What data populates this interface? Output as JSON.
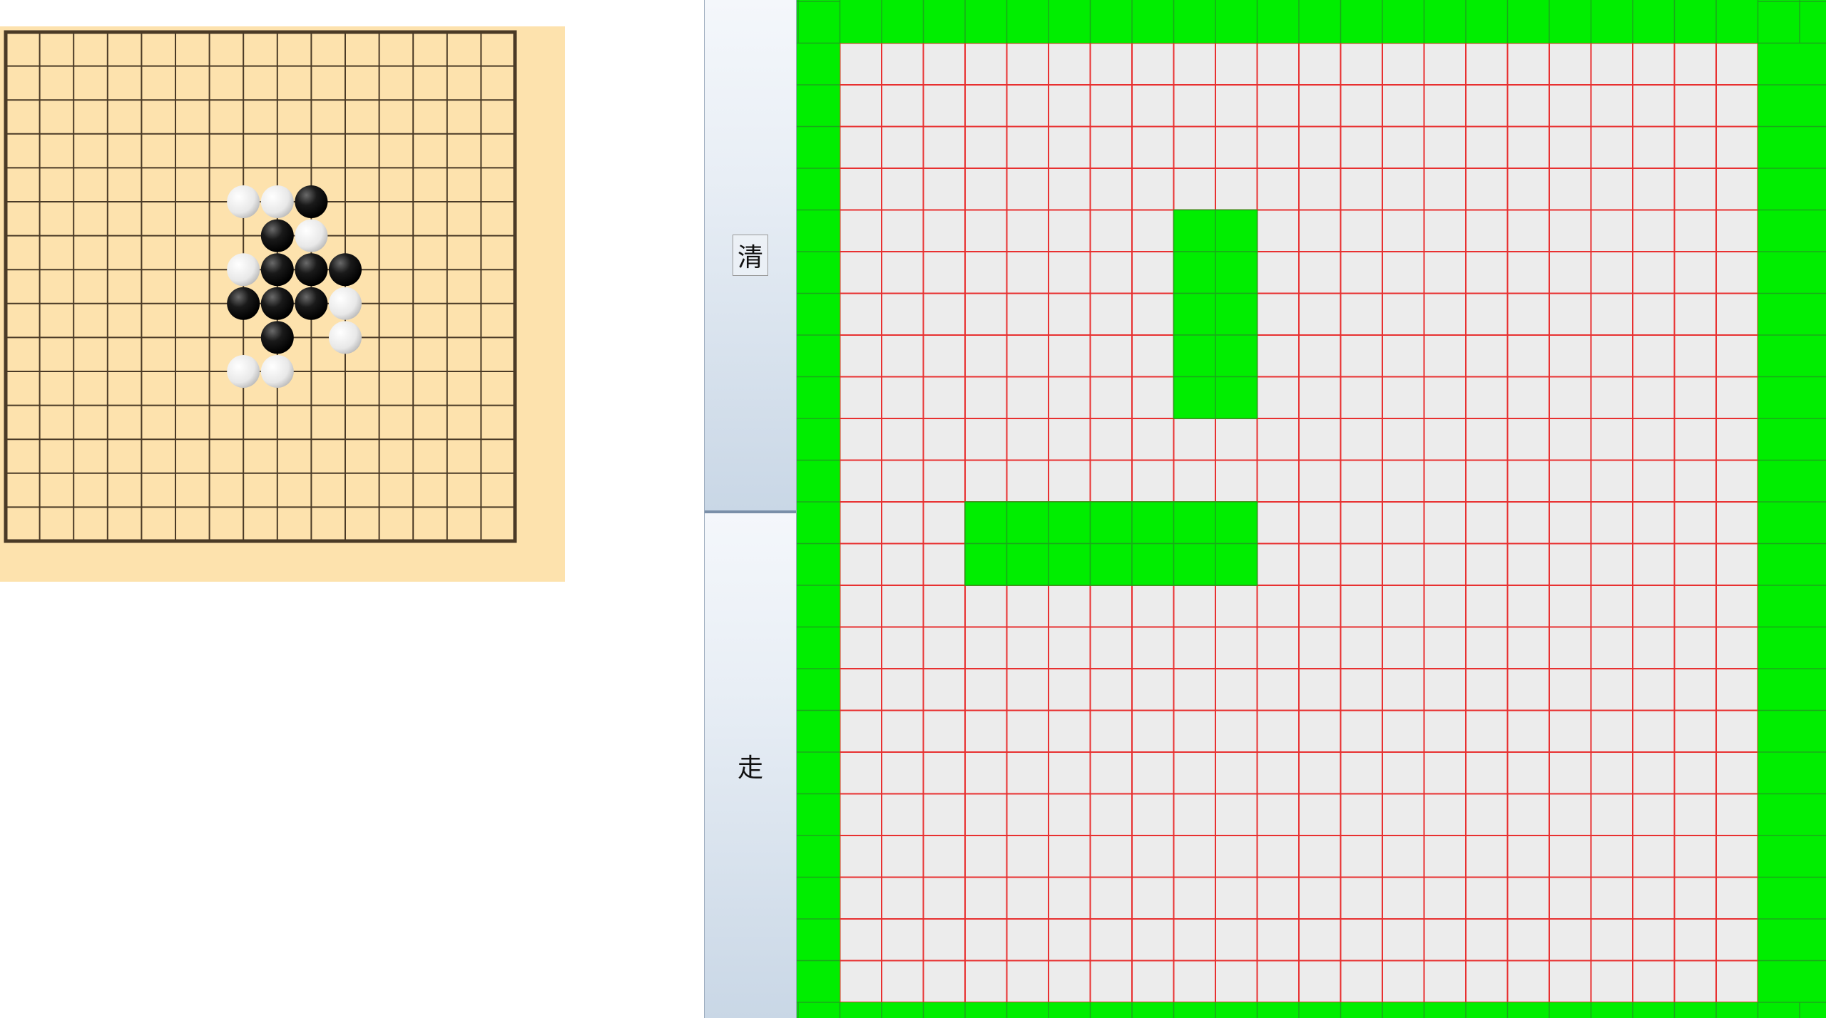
{
  "go_board": {
    "lines": 16,
    "colors": {
      "board": "#fde2ad",
      "line": "#4a3a26"
    },
    "stones": [
      {
        "color": "white",
        "col": 7,
        "row": 5
      },
      {
        "color": "white",
        "col": 8,
        "row": 5
      },
      {
        "color": "black",
        "col": 9,
        "row": 5
      },
      {
        "color": "black",
        "col": 8,
        "row": 6
      },
      {
        "color": "white",
        "col": 9,
        "row": 6
      },
      {
        "color": "white",
        "col": 7,
        "row": 7
      },
      {
        "color": "black",
        "col": 8,
        "row": 7
      },
      {
        "color": "black",
        "col": 9,
        "row": 7
      },
      {
        "color": "black",
        "col": 10,
        "row": 7
      },
      {
        "color": "black",
        "col": 7,
        "row": 8
      },
      {
        "color": "black",
        "col": 8,
        "row": 8
      },
      {
        "color": "black",
        "col": 9,
        "row": 8
      },
      {
        "color": "white",
        "col": 10,
        "row": 8
      },
      {
        "color": "black",
        "col": 8,
        "row": 9
      },
      {
        "color": "white",
        "col": 10,
        "row": 9
      },
      {
        "color": "white",
        "col": 7,
        "row": 10
      },
      {
        "color": "white",
        "col": 8,
        "row": 10
      }
    ]
  },
  "controls": {
    "clear_label": "清",
    "walk_label": "走"
  },
  "snake_grid": {
    "columns": 24,
    "rows": 24,
    "colors": {
      "background": "#ececec",
      "line": "#e83030",
      "wall": "#00ee00",
      "snake": "#00ee00"
    },
    "snake_cells": [
      [
        9,
        5
      ],
      [
        10,
        5
      ],
      [
        9,
        6
      ],
      [
        10,
        6
      ],
      [
        9,
        7
      ],
      [
        10,
        7
      ],
      [
        9,
        8
      ],
      [
        10,
        8
      ],
      [
        9,
        9
      ],
      [
        10,
        9
      ],
      [
        4,
        12
      ],
      [
        5,
        12
      ],
      [
        6,
        12
      ],
      [
        7,
        12
      ],
      [
        8,
        12
      ],
      [
        9,
        12
      ],
      [
        10,
        12
      ],
      [
        4,
        13
      ],
      [
        5,
        13
      ],
      [
        6,
        13
      ],
      [
        7,
        13
      ],
      [
        8,
        13
      ],
      [
        9,
        13
      ],
      [
        10,
        13
      ]
    ]
  }
}
